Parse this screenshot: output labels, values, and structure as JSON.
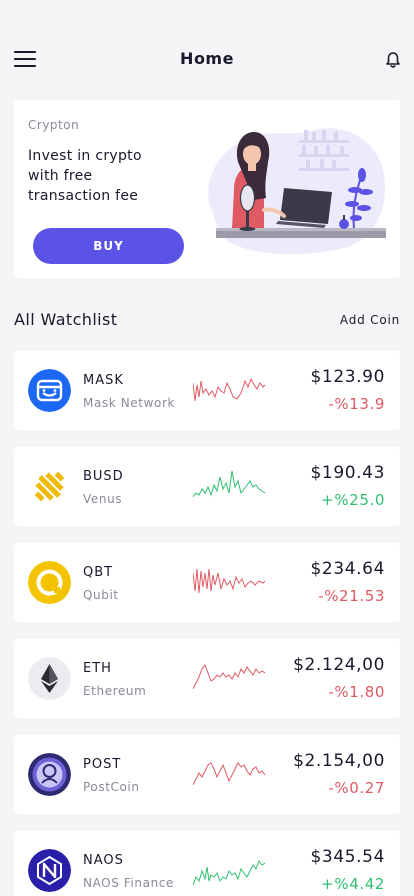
{
  "header": {
    "title": "Home",
    "menu_icon": "hamburger-menu-icon",
    "notification_icon": "bell-icon"
  },
  "promo": {
    "brand": "Crypton",
    "headline_lines": [
      "Invest in crypto",
      "with free",
      "transaction fee"
    ],
    "button_label": "BUY",
    "button_color": "#5b52e6"
  },
  "watchlist": {
    "title": "All Watchlist",
    "add_label": "Add Coin",
    "coins": [
      {
        "symbol": "MASK",
        "name": "Mask Network",
        "price": "$123.90",
        "change": "-%13.9",
        "trend": "down",
        "logo_icon": "mask-network-logo-icon"
      },
      {
        "symbol": "BUSD",
        "name": "Venus",
        "price": "$190.43",
        "change": "+%25.0",
        "trend": "up",
        "logo_icon": "busd-logo-icon"
      },
      {
        "symbol": "QBT",
        "name": "Qubit",
        "price": "$234.64",
        "change": "-%21.53",
        "trend": "down",
        "logo_icon": "qubit-logo-icon"
      },
      {
        "symbol": "ETH",
        "name": "Ethereum",
        "price": "$2.124,00",
        "change": "-%1.80",
        "trend": "down",
        "logo_icon": "ethereum-logo-icon"
      },
      {
        "symbol": "POST",
        "name": "PostCoin",
        "price": "$2.154,00",
        "change": "-%0.27",
        "trend": "down",
        "logo_icon": "postcoin-logo-icon"
      },
      {
        "symbol": "NAOS",
        "name": "NAOS Finance",
        "price": "$345.54",
        "change": "+%4.42",
        "trend": "up",
        "logo_icon": "naos-logo-icon"
      }
    ]
  },
  "colors": {
    "up": "#2fbf71",
    "down": "#e05a63",
    "accent": "#5b52e6"
  }
}
